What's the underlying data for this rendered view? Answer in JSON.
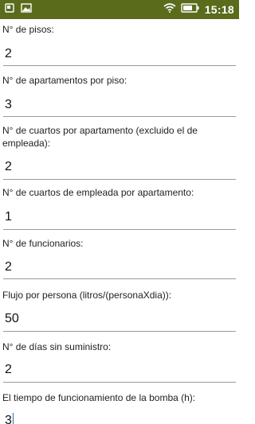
{
  "status_bar": {
    "time": "15:18",
    "left_icons": [
      "notification-icon",
      "image-icon"
    ],
    "right_icons": [
      "wifi-icon",
      "battery-icon"
    ]
  },
  "form": {
    "fields": [
      {
        "label": "N° de pisos:",
        "value": "2"
      },
      {
        "label": "N° de apartamentos por piso:",
        "value": "3"
      },
      {
        "label": "N° de cuartos por apartamento  (excluido el de empleada):",
        "value": "2"
      },
      {
        "label": "N° de cuartos de empleada por apartamento:",
        "value": "1"
      },
      {
        "label": "N° de funcionarios:",
        "value": "2"
      },
      {
        "label": "Flujo por persona (litros/(personaXdia)):",
        "value": "50"
      },
      {
        "label": "N° de días sin suministro:",
        "value": "2"
      },
      {
        "label": "El tiempo de funcionamiento de la bomba (h):",
        "value": "3"
      }
    ]
  },
  "colors": {
    "status_bar_bg": "#5a6b1c",
    "underline": "#9a9a9a",
    "cursor": "#2a6fb8"
  }
}
